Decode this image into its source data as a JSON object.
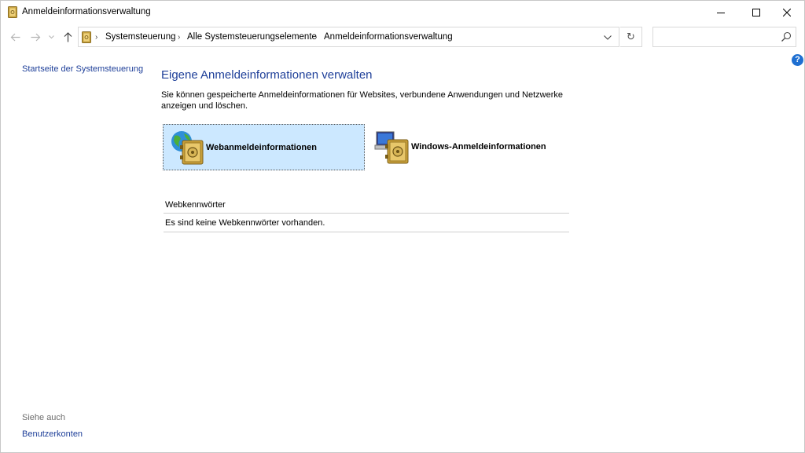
{
  "window": {
    "title": "Anmeldeinformationsverwaltung"
  },
  "breadcrumb": [
    "Systemsteuerung",
    "Alle Systemsteuerungselemente",
    "Anmeldeinformationsverwaltung"
  ],
  "search": {
    "placeholder": "",
    "value": ""
  },
  "left_pane": {
    "home_link": "Startseite der Systemsteuerung",
    "see_also": "Siehe auch",
    "user_accounts_link": "Benutzerkonten"
  },
  "main": {
    "heading": "Eigene Anmeldeinformationen verwalten",
    "description": "Sie können gespeicherte Anmeldeinformationen für Websites, verbundene Anwendungen und Netzwerke anzeigen und löschen.",
    "tiles": [
      {
        "label": "Webanmeldeinformationen",
        "icon": "web-credentials-icon",
        "selected": true
      },
      {
        "label": "Windows-Anmeldeinformationen",
        "icon": "windows-credentials-icon",
        "selected": false
      }
    ],
    "section_title": "Webkennwörter",
    "section_empty": "Es sind keine Webkennwörter vorhanden."
  },
  "colors": {
    "link": "#1e3f99",
    "selected_tile": "#cce8ff",
    "help": "#1f6fd1"
  }
}
